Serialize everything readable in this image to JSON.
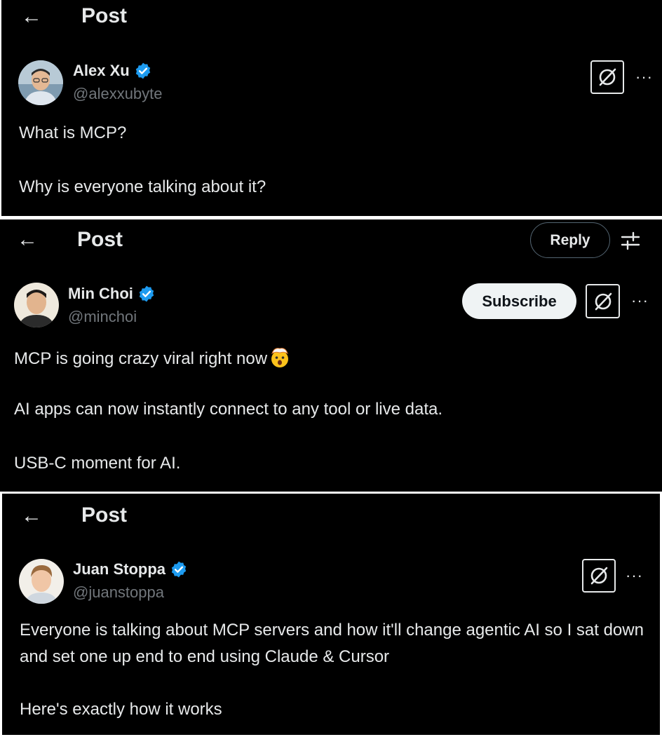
{
  "posts": [
    {
      "header": {
        "back_icon": "←",
        "title": "Post"
      },
      "author": {
        "name": "Alex Xu",
        "handle": "@alexxubyte",
        "verified": true
      },
      "more_icon": "···",
      "lines": [
        "What is MCP?",
        "Why is everyone talking about it?"
      ]
    },
    {
      "header": {
        "back_icon": "←",
        "title": "Post",
        "reply_label": "Reply"
      },
      "author": {
        "name": "Min Choi",
        "handle": "@minchoi",
        "verified": true
      },
      "subscribe_label": "Subscribe",
      "more_icon": "···",
      "lines": [
        "MCP is going crazy viral right now",
        "AI apps can now instantly connect to any tool or live data.",
        "USB-C moment for AI."
      ]
    },
    {
      "header": {
        "back_icon": "←",
        "title": "Post"
      },
      "author": {
        "name": "Juan Stoppa",
        "handle": "@juanstoppa",
        "verified": true
      },
      "more_icon": "···",
      "lines": [
        "Everyone is talking about MCP servers and how it'll change agentic AI so I sat down and set one up end to end using Claude & Cursor",
        "Here's exactly how it works"
      ]
    }
  ],
  "colors": {
    "background": "#000000",
    "text": "#e7e9ea",
    "handle": "#71767b",
    "verified": "#1d9bf0"
  },
  "icons": {
    "back": "arrow-left-icon",
    "grok": "grok-icon",
    "verified": "verified-badge-icon",
    "filter": "sliders-icon",
    "more": "more-icon",
    "emoji": "exploding-head-emoji"
  }
}
